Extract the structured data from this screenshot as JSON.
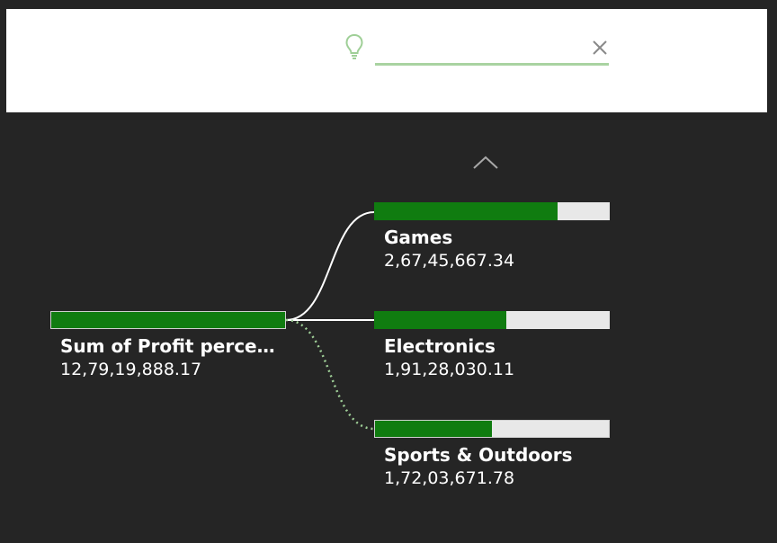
{
  "search": {
    "value": "",
    "placeholder": ""
  },
  "icons": {
    "bulb": "lightbulb-icon",
    "clear": "close-icon",
    "collapse": "chevron-up-icon"
  },
  "colors": {
    "accent": "#107c10",
    "search_underline": "#a9d3a1",
    "background": "#252525",
    "bar_track": "#e8e8e8"
  },
  "decomposition_tree": {
    "root": {
      "label": "Sum of Profit percen...",
      "value": "12,79,19,888.17",
      "fill_fraction": 1.0
    },
    "children": [
      {
        "label": "Games",
        "value": "2,67,45,667.34",
        "fill_fraction": 0.78,
        "selected": false
      },
      {
        "label": "Electronics",
        "value": "1,91,28,030.11",
        "fill_fraction": 0.56,
        "selected": false
      },
      {
        "label": "Sports & Outdoors",
        "value": "1,72,03,671.78",
        "fill_fraction": 0.5,
        "selected": true
      }
    ]
  }
}
